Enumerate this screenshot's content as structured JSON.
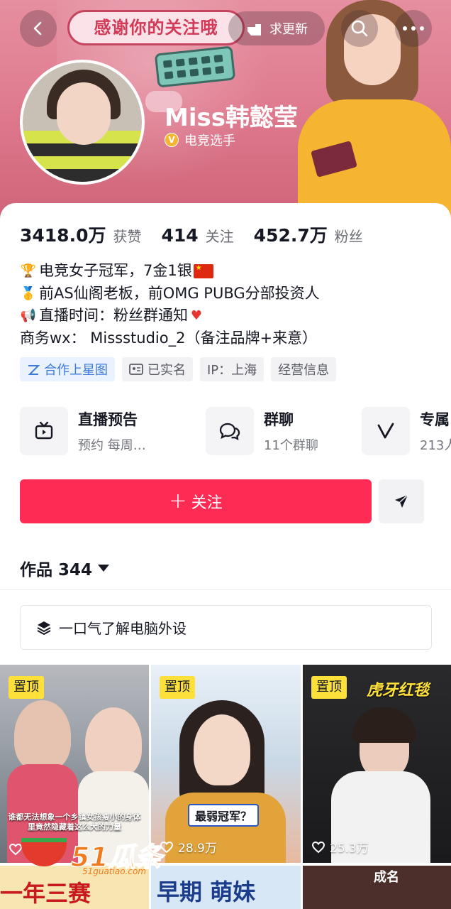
{
  "header": {
    "banner_text": "感谢你的关注哦",
    "update_label": "求更新"
  },
  "profile": {
    "name": "Miss韩懿莹",
    "verification_label": "电竞选手",
    "stats": [
      {
        "value": "3418.0万",
        "label": "获赞"
      },
      {
        "value": "414",
        "label": "关注"
      },
      {
        "value": "452.7万",
        "label": "粉丝"
      }
    ],
    "bio": {
      "line1": "电竞女子冠军，7金1银",
      "line2": "前AS仙阁老板，前OMG PUBG分部投资人",
      "line3": "直播时间：粉丝群通知",
      "line4": "商务wx：   Missstudio_2（备注品牌+来意）"
    },
    "tags": [
      "合作上星图",
      "已实名",
      "IP：上海",
      "经营信息"
    ]
  },
  "features": [
    {
      "title": "直播预告",
      "subtitle": "预约 每周…",
      "icon": "tv-icon"
    },
    {
      "title": "群聊",
      "subtitle": "11个群聊",
      "icon": "chat-bubbles-icon"
    },
    {
      "title": "专属",
      "subtitle": "213人",
      "icon": "v-icon"
    }
  ],
  "actions": {
    "follow_label": "关注"
  },
  "works": {
    "label": "作品 344",
    "collection_label": "一口气了解电脑外设"
  },
  "videos": [
    {
      "pinned_label": "置顶",
      "likes": "",
      "caption": "谁都无法想象一个乡镇女孩瘦小的身体里竟然隐藏着这么大的力量"
    },
    {
      "pinned_label": "置顶",
      "likes": "28.9万",
      "caption": "最弱冠军？"
    },
    {
      "pinned_label": "置顶",
      "likes": "25.3万",
      "caption": "虎牙红毯"
    }
  ],
  "row2_captions": [
    "一年三赛",
    "早期 萌妹",
    "成名"
  ],
  "watermark": {
    "text": "51瓜条",
    "url": "51guatiao.com"
  },
  "colors": {
    "accent": "#fe2c55",
    "pin": "#fde03a",
    "banner": "#e07c90"
  }
}
